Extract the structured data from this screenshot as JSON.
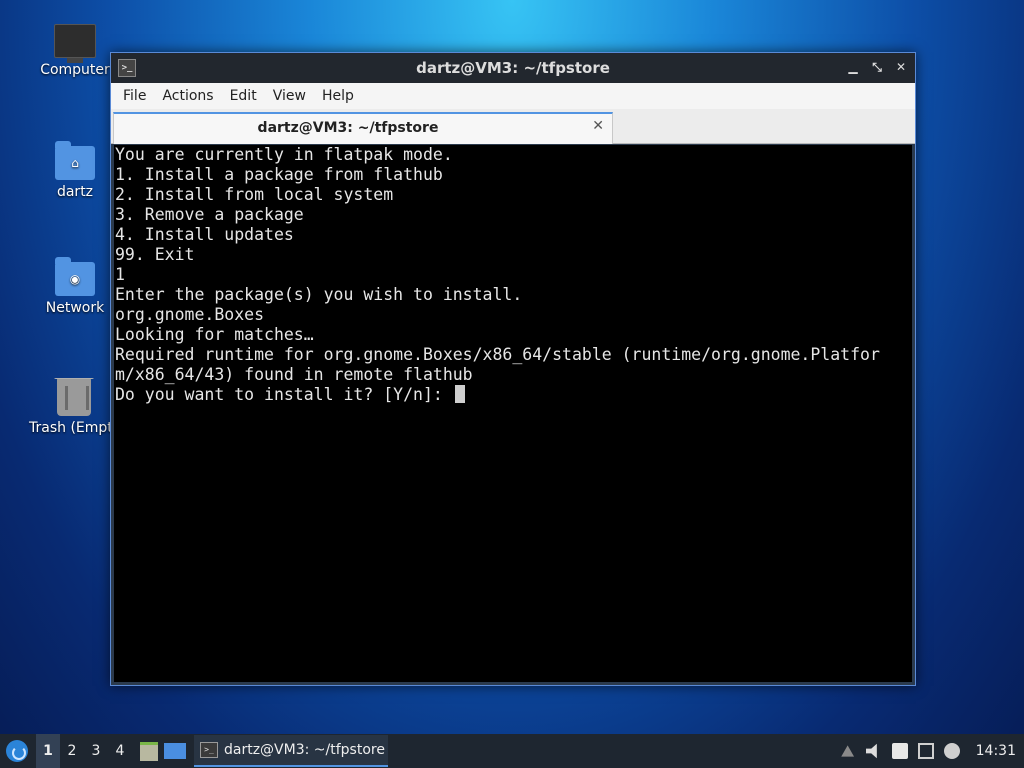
{
  "desktop": {
    "icons": [
      {
        "label": "Computer"
      },
      {
        "label": "dartz"
      },
      {
        "label": "Network"
      },
      {
        "label": "Trash (Empt"
      }
    ]
  },
  "window": {
    "title": "dartz@VM3: ~/tfpstore",
    "menu": [
      "File",
      "Actions",
      "Edit",
      "View",
      "Help"
    ],
    "tab": {
      "label": "dartz@VM3: ~/tfpstore"
    },
    "terminal_lines": [
      "You are currently in flatpak mode.",
      "1. Install a package from flathub",
      "2. Install from local system",
      "3. Remove a package",
      "4. Install updates",
      "99. Exit",
      "1",
      "Enter the package(s) you wish to install.",
      "org.gnome.Boxes",
      "Looking for matches…",
      "Required runtime for org.gnome.Boxes/x86_64/stable (runtime/org.gnome.Platfor",
      "m/x86_64/43) found in remote flathub",
      "Do you want to install it? [Y/n]: "
    ]
  },
  "taskbar": {
    "workspaces": [
      "1",
      "2",
      "3",
      "4"
    ],
    "active_workspace": "1",
    "task_label": "dartz@VM3: ~/tfpstore",
    "clock": "14:31"
  },
  "colors": {
    "accent": "#5294e2",
    "terminal_bg": "#000000",
    "taskbar_bg": "#1e2630"
  }
}
